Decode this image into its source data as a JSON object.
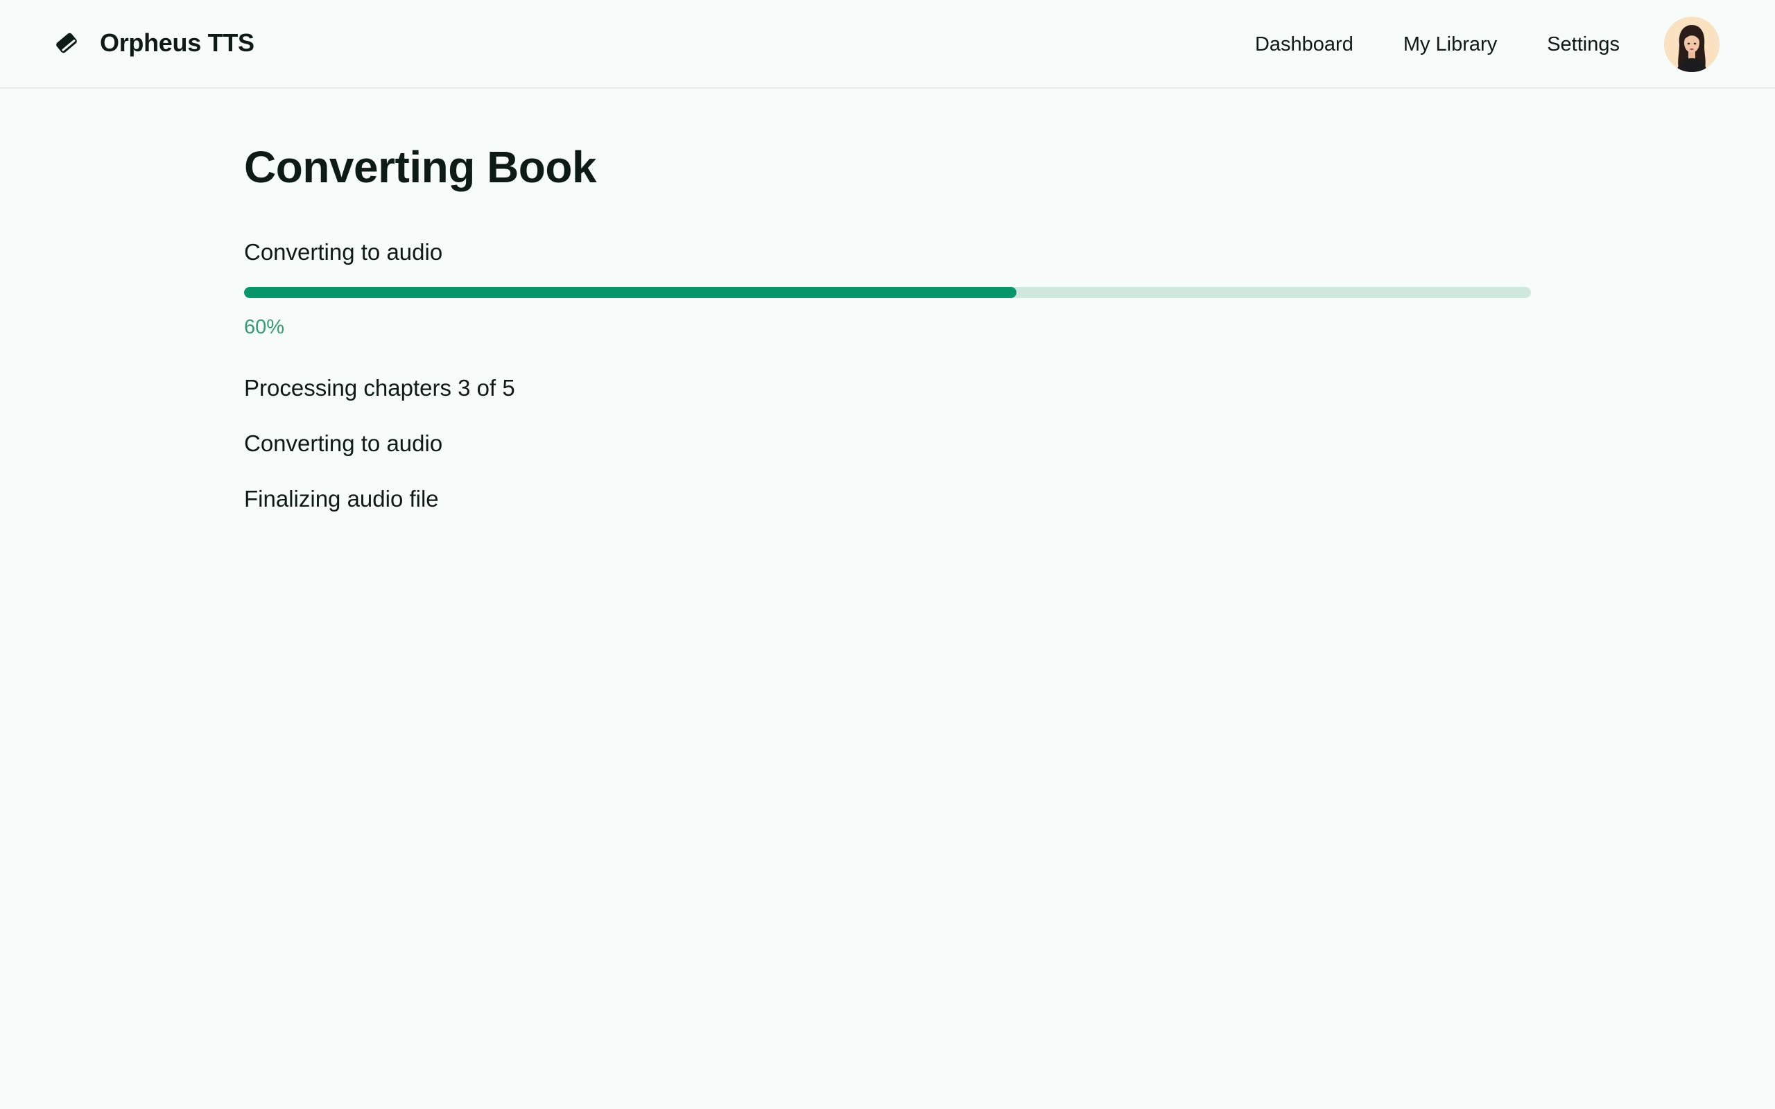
{
  "app": {
    "name": "Orpheus TTS",
    "brand_icon": "book-icon"
  },
  "nav": {
    "items": [
      {
        "label": "Dashboard"
      },
      {
        "label": "My Library"
      },
      {
        "label": "Settings"
      }
    ],
    "avatar_icon": "user-avatar"
  },
  "page": {
    "title": "Converting Book"
  },
  "progress": {
    "label": "Converting to audio",
    "value": 0.6,
    "percent_text": "60%",
    "fill_color": "#079669",
    "track_color": "#cfe8de"
  },
  "steps": [
    {
      "text": "Processing chapters 3 of 5"
    },
    {
      "text": "Converting to audio"
    },
    {
      "text": "Finalizing audio file"
    }
  ]
}
